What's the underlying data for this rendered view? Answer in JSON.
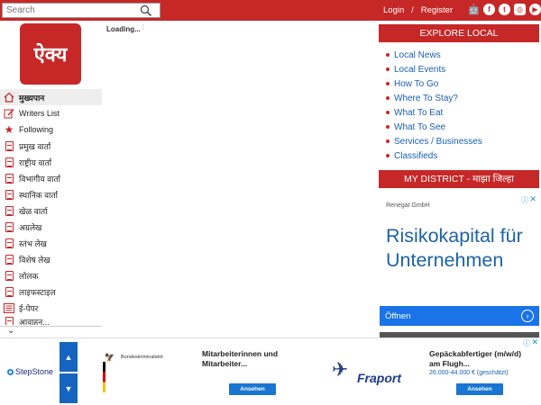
{
  "header": {
    "search_placeholder": "Search",
    "login": "Login",
    "separator": "/",
    "register": "Register",
    "social_icons": [
      "apple-icon",
      "android-icon",
      "facebook-icon",
      "twitter-icon",
      "instagram-icon",
      "youtube-icon"
    ],
    "accent_color": "#c62828"
  },
  "logo": {
    "text": "ऐक्य"
  },
  "loading": {
    "text": "Loading..."
  },
  "nav": {
    "items": [
      {
        "label": "मुख्यपान",
        "icon": "home-icon"
      },
      {
        "label": "Writers List",
        "icon": "edit-icon"
      },
      {
        "label": "Following",
        "icon": "star-icon"
      },
      {
        "label": "प्रमुख वार्ता",
        "icon": "document-icon"
      },
      {
        "label": "राष्ट्रीय वार्ता",
        "icon": "document-icon"
      },
      {
        "label": "विभागीय वार्ता",
        "icon": "document-icon"
      },
      {
        "label": "स्थानिक वार्ता",
        "icon": "document-icon"
      },
      {
        "label": "खेळ वार्ता",
        "icon": "document-icon"
      },
      {
        "label": "अग्रलेख",
        "icon": "document-icon"
      },
      {
        "label": "स्तंभ लेख",
        "icon": "document-icon"
      },
      {
        "label": "विशेष लेख",
        "icon": "document-icon"
      },
      {
        "label": "लोलक",
        "icon": "document-icon"
      },
      {
        "label": "लाइफस्टाइल",
        "icon": "document-icon"
      },
      {
        "label": "ई-पेपर",
        "icon": "newspaper-icon"
      },
      {
        "label": "आवाहन...",
        "icon": "document-icon"
      }
    ]
  },
  "explore": {
    "title": "EXPLORE LOCAL",
    "links": [
      "Local News",
      "Local Events",
      "How To Go",
      "Where To Stay?",
      "What To Eat",
      "What To See",
      "Services / Businesses",
      "Classifieds"
    ]
  },
  "district": {
    "title": "MY DISTRICT - माझा जिल्हा"
  },
  "ad_right": {
    "advertiser": "Renegat GmbH",
    "headline": "Risikokapital für Unternehmen",
    "cta": "Öffnen"
  },
  "banner": {
    "stepstone": "StepStone",
    "bka_name": "Bundeskriminalamt",
    "job1": "Mitarbeiterinnen und Mitarbeiter...",
    "job1_button": "Ansehen",
    "fraport": "Fraport",
    "job2": "Gepäckabfertiger (m/w/d) am Flugh...",
    "job2_salary": "26.000-44.000 € (geschätzt)",
    "job2_button": "Ansehen"
  }
}
